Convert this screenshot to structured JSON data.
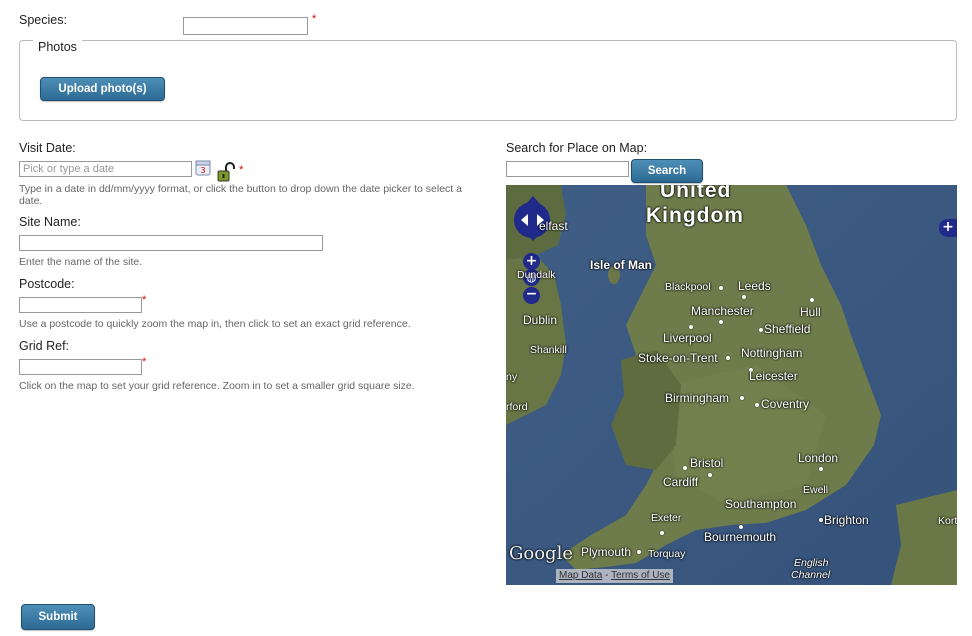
{
  "species": {
    "label": "Species:",
    "value": "",
    "required_mark": "*"
  },
  "photos": {
    "legend": "Photos",
    "upload_label": "Upload photo(s)"
  },
  "visit_date": {
    "label": "Visit Date:",
    "placeholder": "Pick or type a date",
    "required_mark": "*",
    "hint": "Type in a date in dd/mm/yyyy format, or click the button to drop down the date picker to select a date."
  },
  "site_name": {
    "label": "Site Name:",
    "value": "",
    "hint": "Enter the name of the site."
  },
  "postcode": {
    "label": "Postcode:",
    "value": "",
    "required_mark": "*",
    "hint": "Use a postcode to quickly zoom the map in, then click to set an exact grid reference."
  },
  "grid_ref": {
    "label": "Grid Ref:",
    "value": "",
    "required_mark": "*",
    "hint": "Click on the map to set your grid reference. Zoom in to set a smaller grid square size."
  },
  "map_search": {
    "label": "Search for Place on Map:",
    "value": "",
    "button_label": "Search"
  },
  "map": {
    "country_line1": "United",
    "country_line2": "Kingdom",
    "isle": "Isle of Man",
    "sea": "English Channel",
    "sea_line1": "English",
    "sea_line2": "Channel",
    "cities": {
      "belfast": "elfast",
      "dundalk": "Dundalk",
      "dublin": "Dublin",
      "shankill": "Shankill",
      "blackpool": "Blackpool",
      "leeds": "Leeds",
      "manchester": "Manchester",
      "hull": "Hull",
      "liverpool": "Liverpool",
      "sheffield": "Sheffield",
      "stoke": "Stoke-on-Trent",
      "nottingham": "Nottingham",
      "leicester": "Leicester",
      "birmingham": "Birmingham",
      "coventry": "Coventry",
      "bristol": "Bristol",
      "cardiff": "Cardiff",
      "london": "London",
      "ewell": "Ewell",
      "southampton": "Southampton",
      "exeter": "Exeter",
      "brighton": "Brighton",
      "bournemouth": "Bournemouth",
      "plymouth": "Plymouth",
      "torquay": "Torquay",
      "ny": "ny",
      "rford": "rford",
      "kort": "Kort"
    },
    "google": "Google",
    "map_data": "Map Data",
    "separator": " - ",
    "terms": "Terms of Use",
    "colors": {
      "sea": "#3e5d84",
      "land": "#6d7a4a",
      "control": "#1f2a8a"
    }
  },
  "submit_label": "Submit"
}
